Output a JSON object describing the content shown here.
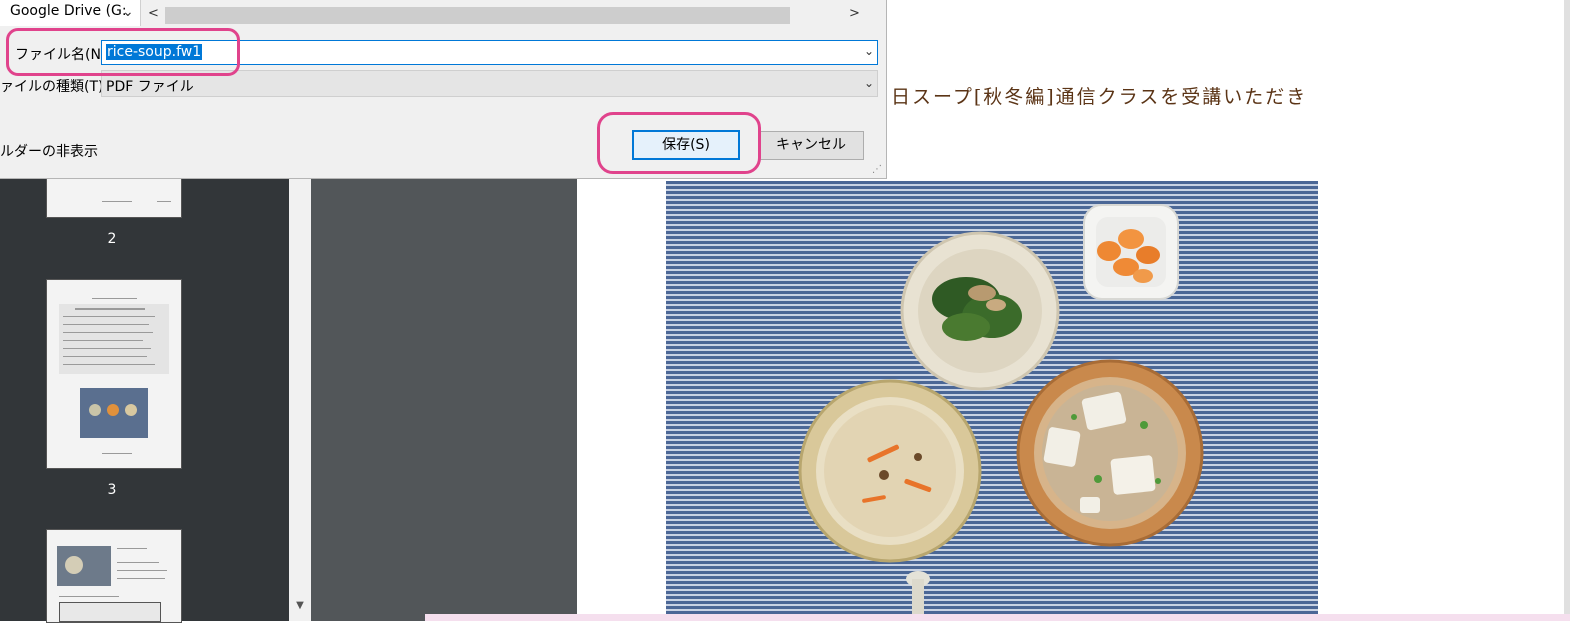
{
  "dialog": {
    "path_label": "Google Drive (G:",
    "file_name_label": "ファイル名(N):",
    "file_name_value": "rice-soup.fw1",
    "file_type_label": "ァイルの種類(T):",
    "file_type_value": "PDF ファイル",
    "hide_folders_label": "ルダーの非表示",
    "save_button": "保存(S)",
    "cancel_button": "キャンセル"
  },
  "sidebar": {
    "pages": [
      "2",
      "3"
    ]
  },
  "document": {
    "heading": "日スープ[秋冬編]通信クラスを受講いただき"
  },
  "icons": {
    "path_chevron": "chevron-down-icon",
    "scroll_left": "chevron-left-icon",
    "scroll_right": "chevron-right-icon",
    "dropdown": "chevron-down-icon",
    "scroll_down": "triangle-down-icon"
  },
  "colors": {
    "accent": "#0078d7",
    "annotation": "#e0438c",
    "sidebar_bg": "#323639",
    "viewer_bg": "#525659"
  }
}
